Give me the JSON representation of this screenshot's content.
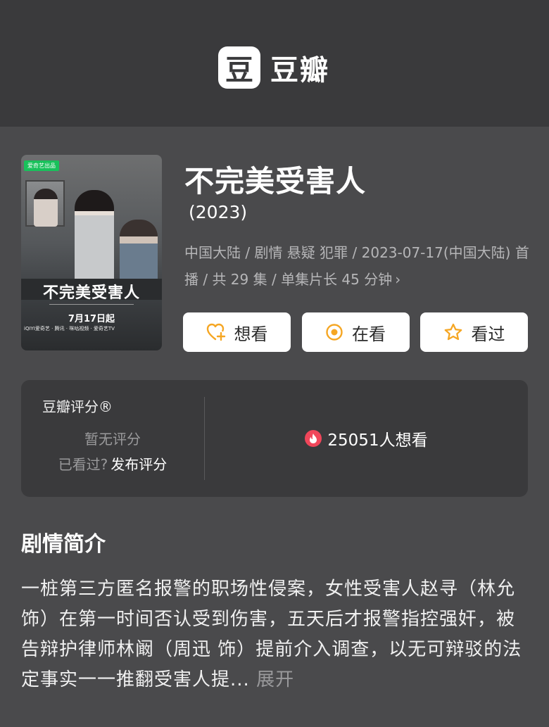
{
  "header": {
    "logo_glyph": "豆",
    "logo_text": "豆瓣"
  },
  "poster": {
    "badge": "爱奇艺出品",
    "title": "不完美受害人",
    "date": "7月17日起",
    "platforms": "iQIYI爱奇艺 · 腾讯 · 咪咕视频 · 爱奇艺TV"
  },
  "movie": {
    "title": "不完美受害人",
    "year": "(2023)",
    "meta_line": "中国大陆 / 剧情 悬疑 犯罪 / 2023-07-17(中国大陆) 首播 / 共 29 集 / 单集片长 45 分钟",
    "meta_chevron": "›"
  },
  "actions": [
    {
      "label": "想看",
      "icon": "heart-plus-icon",
      "color": "#f5a623"
    },
    {
      "label": "在看",
      "icon": "target-icon",
      "color": "#f5a623"
    },
    {
      "label": "看过",
      "icon": "star-icon",
      "color": "#f5a623"
    }
  ],
  "rating": {
    "title": "豆瓣评分®",
    "no_rating": "暂无评分",
    "watched_prompt": "已看过?",
    "publish_label": "发布评分",
    "want_count": "25051人想看",
    "fire_color": "#f0465a"
  },
  "synopsis": {
    "heading": "剧情简介",
    "text": "一桩第三方匿名报警的职场性侵案，女性受害人赵寻（林允 饰）在第一时间否认受到伤害，五天后才报警指控强奸，被告辩护律师林阚（周迅 饰）提前介入调查，以无可辩驳的法定事实一一推翻受害人提... ",
    "expand_label": "展开"
  }
}
